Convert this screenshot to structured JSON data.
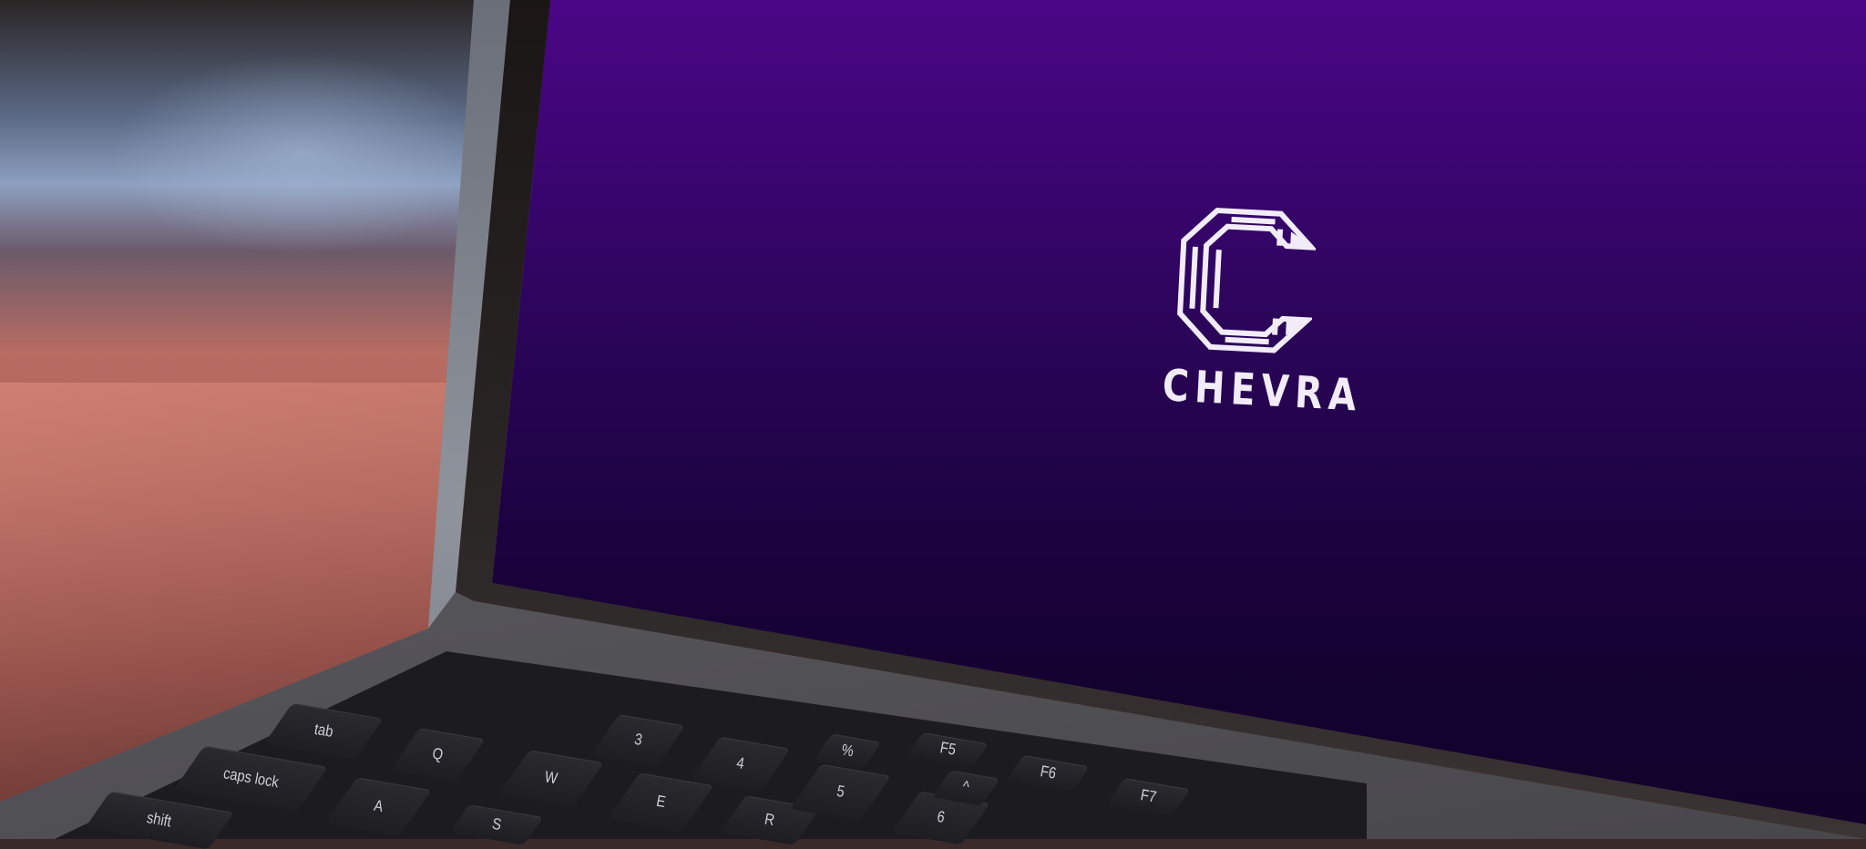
{
  "screen": {
    "brand_name": "CHEVRA",
    "logo_icon": "chevra-c-logo-icon",
    "colors": {
      "top": "#4b0685",
      "bottom": "#11022a",
      "logo": "#f2ecf8"
    }
  },
  "keyboard": {
    "keys": [
      {
        "id": "tab",
        "label": "tab"
      },
      {
        "id": "q",
        "label": "Q"
      },
      {
        "id": "w",
        "label": "W"
      },
      {
        "id": "e",
        "label": "E"
      },
      {
        "id": "r",
        "label": "R"
      },
      {
        "id": "caps",
        "label": "caps lock"
      },
      {
        "id": "a",
        "label": "A"
      },
      {
        "id": "s",
        "label": "S"
      },
      {
        "id": "shift",
        "label": "shift"
      },
      {
        "id": "3",
        "label": "3"
      },
      {
        "id": "4",
        "label": "4"
      },
      {
        "id": "5",
        "label": "5"
      },
      {
        "id": "6",
        "label": "6"
      },
      {
        "id": "pct",
        "label": "%"
      },
      {
        "id": "caret",
        "label": "^"
      },
      {
        "id": "f5",
        "label": "F5"
      },
      {
        "id": "f6",
        "label": "F6"
      },
      {
        "id": "f7",
        "label": "F7"
      }
    ]
  }
}
